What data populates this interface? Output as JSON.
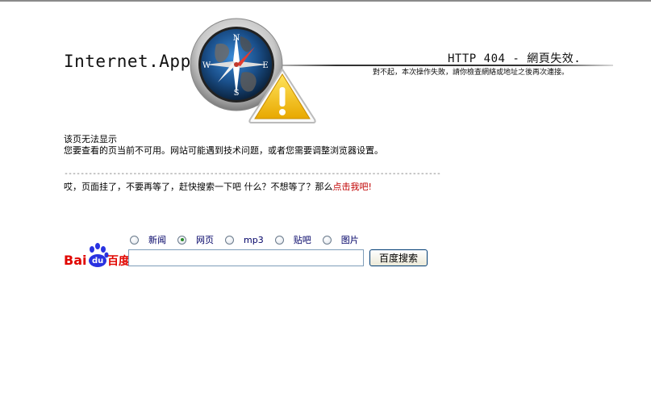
{
  "header": {
    "brand": "Internet.App",
    "http_title": "HTTP 404 - 網頁失效.",
    "http_subtitle": "對不起，本次操作失敗，請你檢查網絡或地址之後再次連接。"
  },
  "compass": {
    "n": "N",
    "e": "E",
    "s": "S",
    "w": "W"
  },
  "message": {
    "title": "该页无法显示",
    "body": "您要查看的页当前不可用。网站可能遇到技术问题，或者您需要调整浏览器设置。",
    "divider": "---------------------------------------------------------------------------------------------",
    "prompt": "哎，页面挂了，不要再等了，赶快搜索一下吧 什么？不想等了？那么",
    "link": "点击我吧!"
  },
  "search": {
    "logo_text": "Baidu百度",
    "options": [
      "新闻",
      "网页",
      "mp3",
      "贴吧",
      "图片"
    ],
    "selected": "网页",
    "query": "",
    "button": "百度搜索"
  },
  "colors": {
    "link": "#c00000",
    "radio_label": "#000066",
    "baidu_red": "#e10601",
    "baidu_blue": "#2932e1",
    "warning_yellow": "#f5c400"
  }
}
